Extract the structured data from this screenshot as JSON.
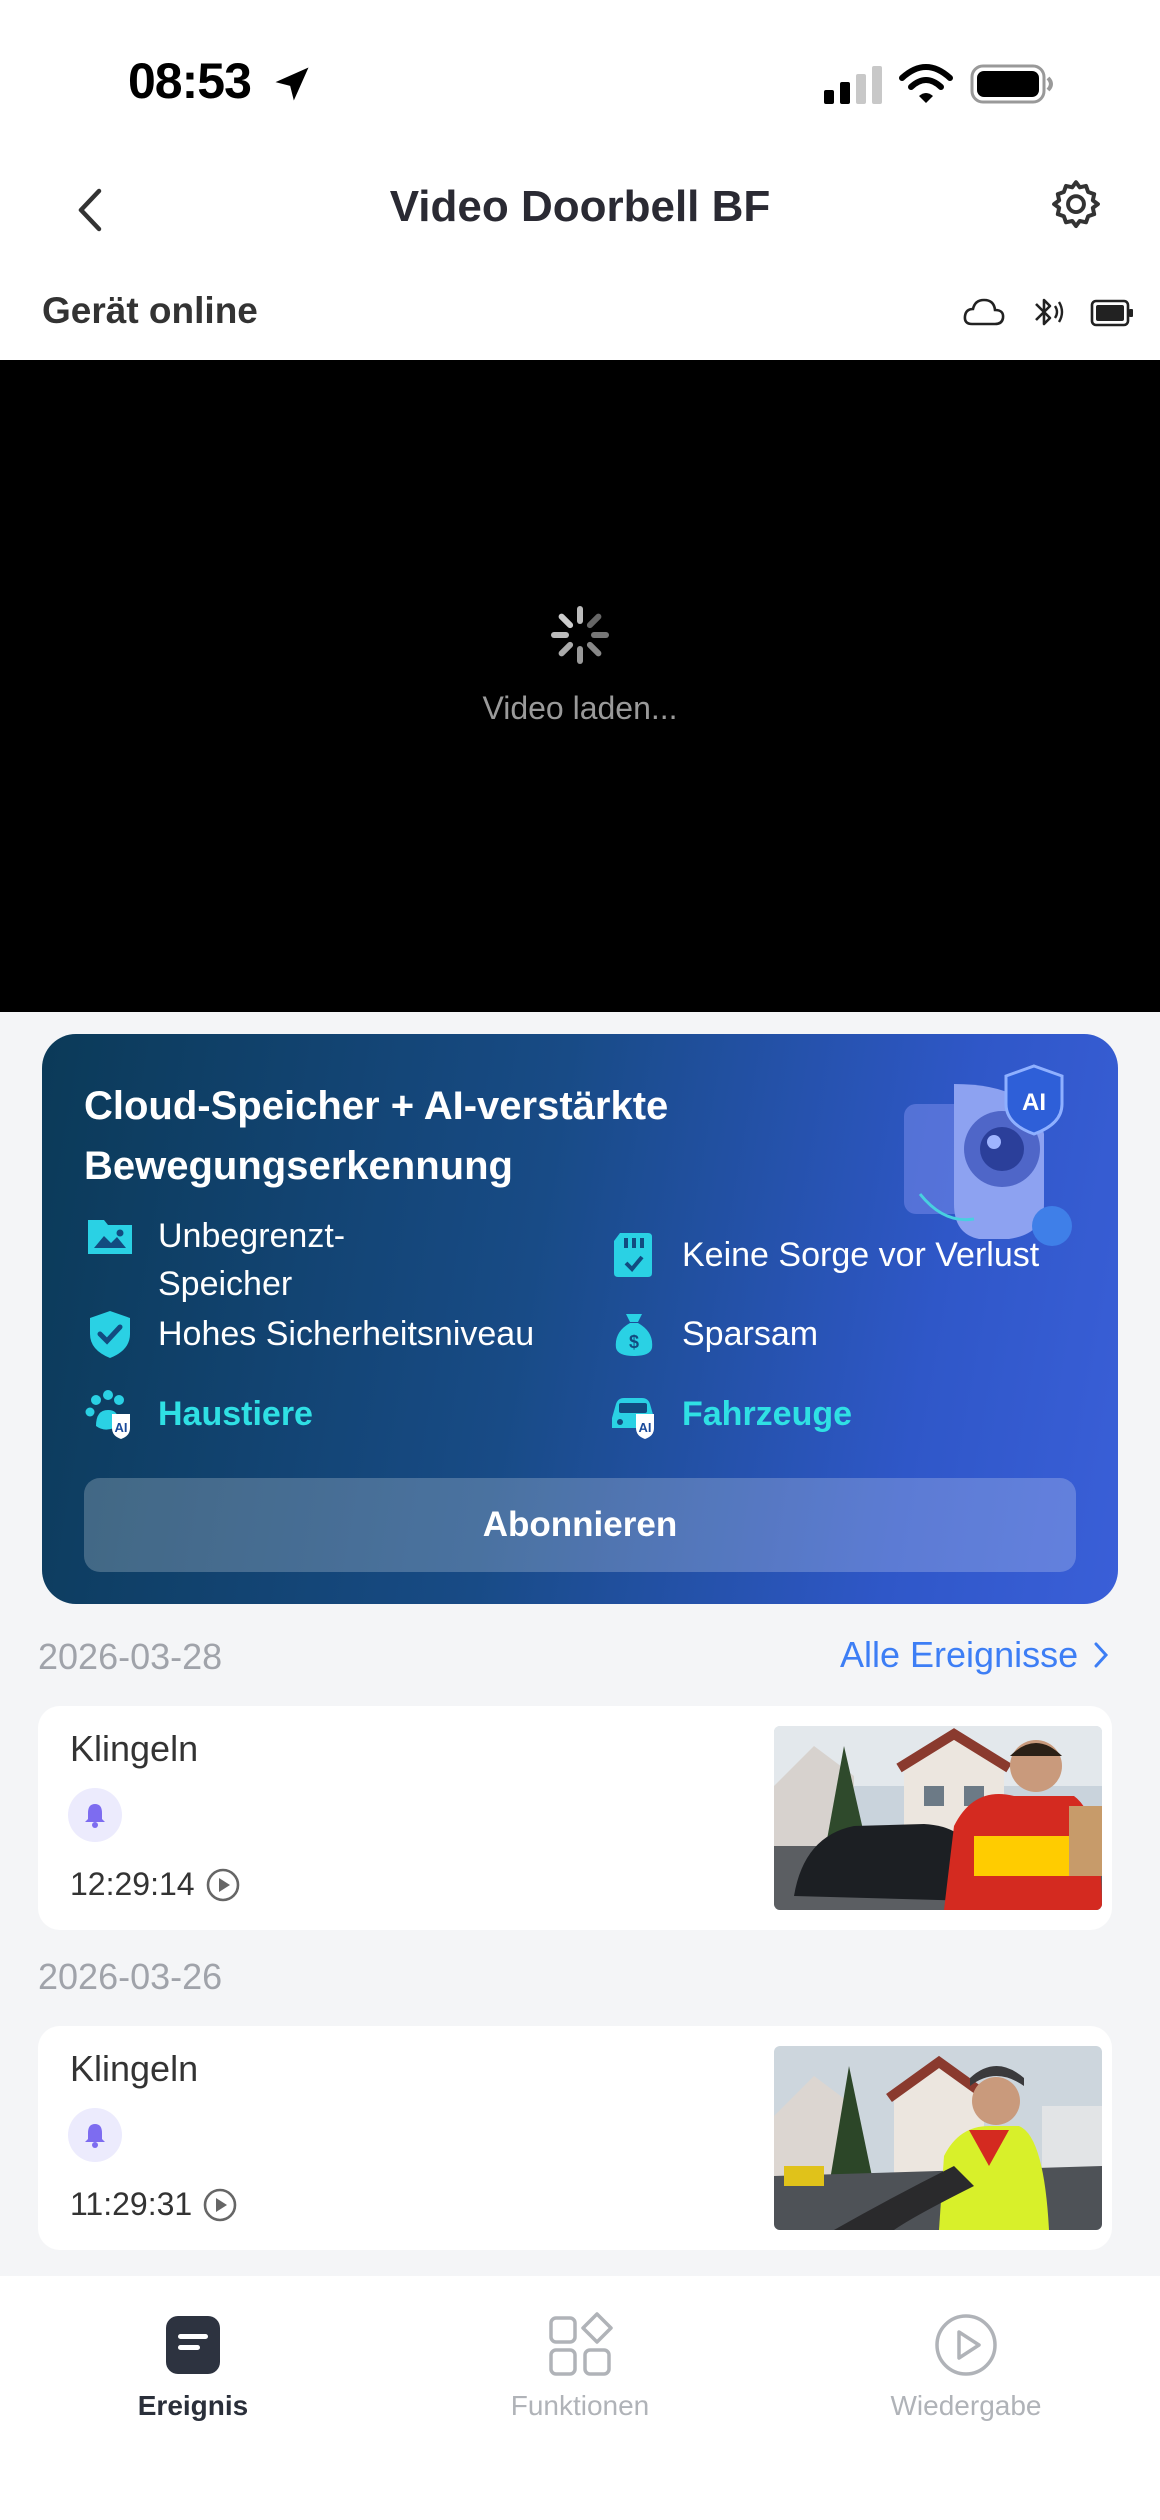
{
  "status_bar": {
    "time": "08:53"
  },
  "header": {
    "title": "Video Doorbell BF",
    "device_status": "Gerät online"
  },
  "video": {
    "loading_text": "Video laden..."
  },
  "promo": {
    "title": "Cloud-Speicher + AI-verstärkte Bewegungserkennung",
    "features": [
      {
        "label": "Unbegrenzt-\nSpeicher",
        "icon": "image-folder-icon"
      },
      {
        "label": "Keine Sorge vor Verlust",
        "icon": "sd-card-icon"
      },
      {
        "label": "Hohes Sicherheitsniveau",
        "icon": "shield-check-icon"
      },
      {
        "label": "Sparsam",
        "icon": "money-bag-icon"
      }
    ],
    "ai_features": [
      {
        "label": "Haustiere",
        "icon": "paw-ai-icon"
      },
      {
        "label": "Fahrzeuge",
        "icon": "car-ai-icon"
      }
    ],
    "subscribe_label": "Abonnieren",
    "colors": {
      "accent_text": "#2fe0e4",
      "gradient_start": "#0b3a58",
      "gradient_end": "#3a5fd8"
    }
  },
  "events": {
    "all_events_label": "Alle Ereignisse",
    "groups": [
      {
        "date": "2026-03-28",
        "items": [
          {
            "title": "Klingeln",
            "time": "12:29:14"
          }
        ]
      },
      {
        "date": "2026-03-26",
        "items": [
          {
            "title": "Klingeln",
            "time": "11:29:31"
          }
        ]
      }
    ]
  },
  "tabbar": {
    "tabs": [
      {
        "label": "Ereignis",
        "icon": "event-list-icon",
        "active": true
      },
      {
        "label": "Funktionen",
        "icon": "grid-icon",
        "active": false
      },
      {
        "label": "Wiedergabe",
        "icon": "play-circle-icon",
        "active": false
      }
    ]
  }
}
